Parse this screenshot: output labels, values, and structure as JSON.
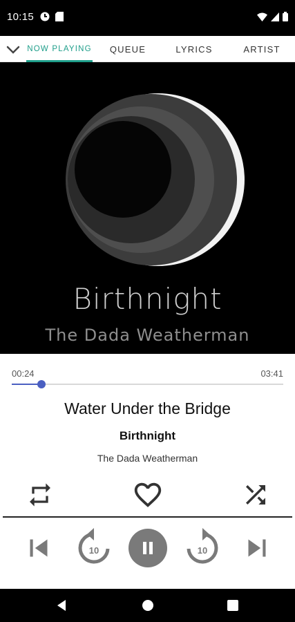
{
  "status_bar": {
    "time": "10:15",
    "icons": [
      "notification-app-icon",
      "sd-card-icon",
      "wifi-icon",
      "signal-icon",
      "battery-icon"
    ]
  },
  "tabs": {
    "collapse_icon": "chevron-down-icon",
    "items": [
      {
        "label": "NOW PLAYING",
        "active": true
      },
      {
        "label": "QUEUE",
        "active": false
      },
      {
        "label": "LYRICS",
        "active": false
      },
      {
        "label": "ARTIST",
        "active": false
      }
    ],
    "accent_color": "#1e9e8a"
  },
  "album_art": {
    "title": "Birthnight",
    "artist": "The Dada Weatherman"
  },
  "playback": {
    "elapsed": "00:24",
    "total": "03:41",
    "progress": 0.11,
    "seek_color": "#4a5fc1"
  },
  "track": {
    "title": "Water Under the Bridge",
    "album": "Birthnight",
    "artist": "The Dada Weatherman"
  },
  "actions": {
    "repeat_icon": "repeat-icon",
    "favorite_icon": "heart-outline-icon",
    "shuffle_icon": "shuffle-icon"
  },
  "controls": {
    "previous_icon": "skip-previous-icon",
    "rewind_label": "10",
    "pause_icon": "pause-icon",
    "forward_label": "10",
    "next_icon": "skip-next-icon"
  },
  "nav_bar": {
    "icons": [
      "back-icon",
      "home-icon",
      "recents-icon"
    ]
  }
}
